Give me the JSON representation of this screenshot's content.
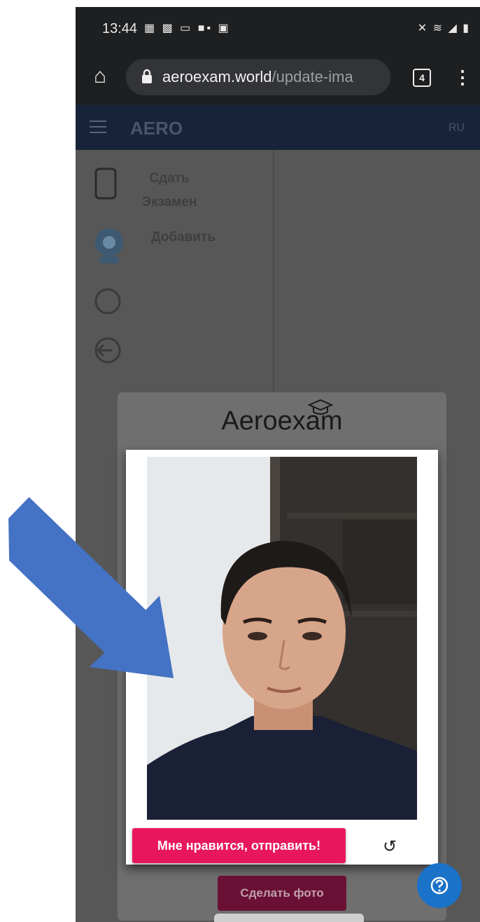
{
  "statusbar": {
    "time": "13:44",
    "left_icons": "▦ ▩ ▭ ■▪ ▣",
    "right_icons": "✕ ≋ ◢ ▮"
  },
  "browser": {
    "url_domain": "aeroexam.world",
    "url_path": "/update-ima",
    "tab_count": "4",
    "menu_glyph": "⋮",
    "home_glyph": "⌂"
  },
  "app": {
    "title": "AERO",
    "lang": "RU",
    "sidebar": [
      {
        "label_line1": "Сдать",
        "label_line2": "Экзамен",
        "icon": "phone-icon"
      },
      {
        "label_line1": "Добавить",
        "icon": "webcam-icon"
      },
      {
        "icon": "webcam-icon-2"
      },
      {
        "icon": "logout-icon"
      }
    ]
  },
  "modal": {
    "logo_text": "Aeroexam",
    "send_button": "Мне нравится, отправить!",
    "retake_glyph": "↺",
    "take_photo_button": "Сделать фото"
  },
  "help": {
    "icon": "help-icon",
    "glyph": "?"
  },
  "colors": {
    "accent": "#e8175d",
    "header": "#17233a",
    "fab": "#1a72c9",
    "arrow": "#4472c4"
  }
}
